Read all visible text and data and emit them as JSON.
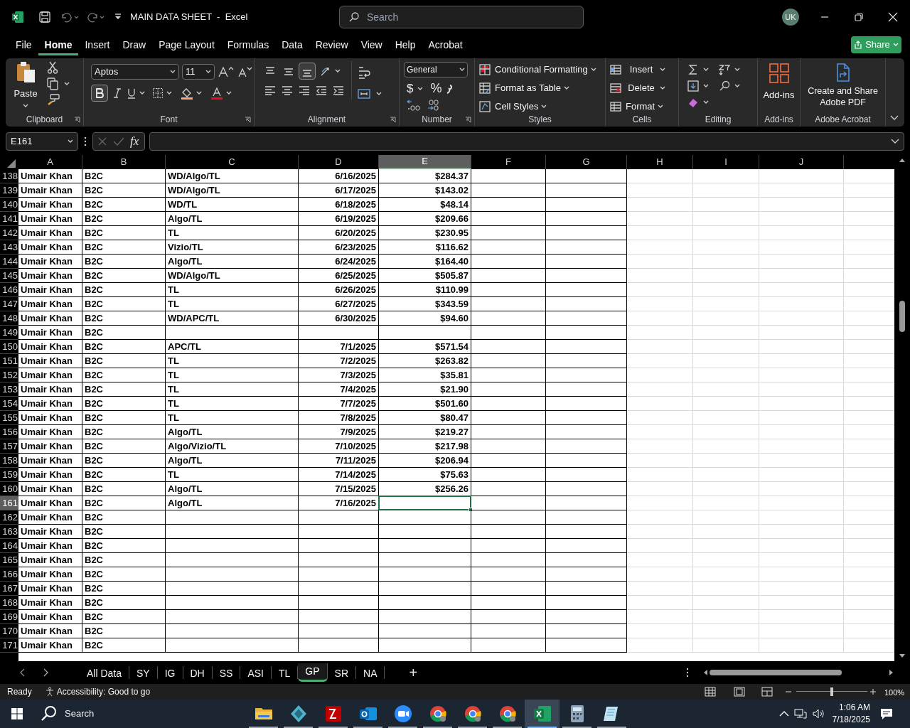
{
  "title_bar": {
    "title": "MAIN DATA SHEET  -  Excel",
    "search_placeholder": "Search",
    "avatar": "UK"
  },
  "menu_tabs": [
    {
      "label": "File",
      "selected": false
    },
    {
      "label": "Home",
      "selected": true
    },
    {
      "label": "Insert",
      "selected": false
    },
    {
      "label": "Draw",
      "selected": false
    },
    {
      "label": "Page Layout",
      "selected": false
    },
    {
      "label": "Formulas",
      "selected": false
    },
    {
      "label": "Data",
      "selected": false
    },
    {
      "label": "Review",
      "selected": false
    },
    {
      "label": "View",
      "selected": false
    },
    {
      "label": "Help",
      "selected": false
    },
    {
      "label": "Acrobat",
      "selected": false
    }
  ],
  "share_button": "Share",
  "ribbon": {
    "clipboard": {
      "label": "Clipboard",
      "paste": "Paste"
    },
    "font": {
      "label": "Font",
      "font_name": "Aptos",
      "font_size": "11",
      "bold_on": true
    },
    "alignment": {
      "label": "Alignment",
      "bottom_align_on": true
    },
    "number": {
      "label": "Number",
      "format": "General",
      "currency_symbol": "$",
      "percent_symbol": "%"
    },
    "styles": {
      "label": "Styles",
      "items": [
        "Conditional Formatting",
        "Format as Table",
        "Cell Styles"
      ]
    },
    "cells": {
      "label": "Cells",
      "items": [
        "Insert",
        "Delete",
        "Format"
      ]
    },
    "editing": {
      "label": "Editing"
    },
    "add_ins": {
      "label": "Add-ins",
      "button": "Add-ins"
    },
    "acrobat": {
      "label": "Adobe Acrobat",
      "button": "Create and Share Adobe PDF"
    }
  },
  "formula_bar": {
    "name_box": "E161",
    "fx": "fx"
  },
  "columns": [
    {
      "label": "A",
      "selected": false
    },
    {
      "label": "B",
      "selected": false
    },
    {
      "label": "C",
      "selected": false
    },
    {
      "label": "D",
      "selected": false
    },
    {
      "label": "E",
      "selected": true
    },
    {
      "label": "F",
      "selected": false
    },
    {
      "label": "G",
      "selected": false
    },
    {
      "label": "H",
      "selected": false
    },
    {
      "label": "I",
      "selected": false
    },
    {
      "label": "J",
      "selected": false
    }
  ],
  "rows": [
    {
      "n": "138",
      "a": "Umair Khan",
      "b": "B2C",
      "c": "WD/Algo/TL",
      "d": "6/16/2025",
      "e": "$284.37",
      "selected": false
    },
    {
      "n": "139",
      "a": "Umair Khan",
      "b": "B2C",
      "c": "WD/Algo/TL",
      "d": "6/17/2025",
      "e": "$143.02",
      "selected": false
    },
    {
      "n": "140",
      "a": "Umair Khan",
      "b": "B2C",
      "c": "WD/TL",
      "d": "6/18/2025",
      "e": "$48.14",
      "selected": false
    },
    {
      "n": "141",
      "a": "Umair Khan",
      "b": "B2C",
      "c": "Algo/TL",
      "d": "6/19/2025",
      "e": "$209.66",
      "selected": false
    },
    {
      "n": "142",
      "a": "Umair Khan",
      "b": "B2C",
      "c": "TL",
      "d": "6/20/2025",
      "e": "$230.95",
      "selected": false
    },
    {
      "n": "143",
      "a": "Umair Khan",
      "b": "B2C",
      "c": "Vizio/TL",
      "d": "6/23/2025",
      "e": "$116.62",
      "selected": false
    },
    {
      "n": "144",
      "a": "Umair Khan",
      "b": "B2C",
      "c": "Algo/TL",
      "d": "6/24/2025",
      "e": "$164.40",
      "selected": false
    },
    {
      "n": "145",
      "a": "Umair Khan",
      "b": "B2C",
      "c": "WD/Algo/TL",
      "d": "6/25/2025",
      "e": "$505.87",
      "selected": false
    },
    {
      "n": "146",
      "a": "Umair Khan",
      "b": "B2C",
      "c": "TL",
      "d": "6/26/2025",
      "e": "$110.99",
      "selected": false
    },
    {
      "n": "147",
      "a": "Umair Khan",
      "b": "B2C",
      "c": "TL",
      "d": "6/27/2025",
      "e": "$343.59",
      "selected": false
    },
    {
      "n": "148",
      "a": "Umair Khan",
      "b": "B2C",
      "c": "WD/APC/TL",
      "d": "6/30/2025",
      "e": "$94.60",
      "selected": false
    },
    {
      "n": "149",
      "a": "Umair Khan",
      "b": "B2C",
      "selected": false
    },
    {
      "n": "150",
      "a": "Umair Khan",
      "b": "B2C",
      "c": "APC/TL",
      "d": "7/1/2025",
      "e": "$571.54",
      "selected": false
    },
    {
      "n": "151",
      "a": "Umair Khan",
      "b": "B2C",
      "c": "TL",
      "d": "7/2/2025",
      "e": "$263.82",
      "selected": false
    },
    {
      "n": "152",
      "a": "Umair Khan",
      "b": "B2C",
      "c": "TL",
      "d": "7/3/2025",
      "e": "$35.81",
      "selected": false
    },
    {
      "n": "153",
      "a": "Umair Khan",
      "b": "B2C",
      "c": "TL",
      "d": "7/4/2025",
      "e": "$21.90",
      "selected": false
    },
    {
      "n": "154",
      "a": "Umair Khan",
      "b": "B2C",
      "c": "TL",
      "d": "7/7/2025",
      "e": "$501.60",
      "selected": false
    },
    {
      "n": "155",
      "a": "Umair Khan",
      "b": "B2C",
      "c": "TL",
      "d": "7/8/2025",
      "e": "$80.47",
      "selected": false
    },
    {
      "n": "156",
      "a": "Umair Khan",
      "b": "B2C",
      "c": "Algo/TL",
      "d": "7/9/2025",
      "e": "$219.27",
      "selected": false
    },
    {
      "n": "157",
      "a": "Umair Khan",
      "b": "B2C",
      "c": "Algo/Vizio/TL",
      "d": "7/10/2025",
      "e": "$217.98",
      "selected": false
    },
    {
      "n": "158",
      "a": "Umair Khan",
      "b": "B2C",
      "c": "Algo/TL",
      "d": "7/11/2025",
      "e": "$206.94",
      "selected": false
    },
    {
      "n": "159",
      "a": "Umair Khan",
      "b": "B2C",
      "c": "TL",
      "d": "7/14/2025",
      "e": "$75.63",
      "selected": false
    },
    {
      "n": "160",
      "a": "Umair Khan",
      "b": "B2C",
      "c": "Algo/TL",
      "d": "7/15/2025",
      "e": "$256.26",
      "selected": false
    },
    {
      "n": "161",
      "a": "Umair Khan",
      "b": "B2C",
      "c": "Algo/TL",
      "d": "7/16/2025",
      "selected": true
    },
    {
      "n": "162",
      "a": "Umair Khan",
      "b": "B2C",
      "selected": false
    },
    {
      "n": "163",
      "a": "Umair Khan",
      "b": "B2C",
      "selected": false
    },
    {
      "n": "164",
      "a": "Umair Khan",
      "b": "B2C",
      "selected": false
    },
    {
      "n": "165",
      "a": "Umair Khan",
      "b": "B2C",
      "selected": false
    },
    {
      "n": "166",
      "a": "Umair Khan",
      "b": "B2C",
      "selected": false
    },
    {
      "n": "167",
      "a": "Umair Khan",
      "b": "B2C",
      "selected": false
    },
    {
      "n": "168",
      "a": "Umair Khan",
      "b": "B2C",
      "selected": false
    },
    {
      "n": "169",
      "a": "Umair Khan",
      "b": "B2C",
      "selected": false
    },
    {
      "n": "170",
      "a": "Umair Khan",
      "b": "B2C",
      "selected": false
    },
    {
      "n": "171",
      "a": "Umair Khan",
      "b": "B2C",
      "selected": false
    }
  ],
  "sheet_tabs": [
    {
      "label": "All Data",
      "selected": false
    },
    {
      "label": "SY",
      "selected": false
    },
    {
      "label": "IG",
      "selected": false
    },
    {
      "label": "DH",
      "selected": false
    },
    {
      "label": "SS",
      "selected": false
    },
    {
      "label": "ASI",
      "selected": false
    },
    {
      "label": "TL",
      "selected": false
    },
    {
      "label": "GP",
      "selected": true
    },
    {
      "label": "SR",
      "selected": false
    },
    {
      "label": "NA",
      "selected": false
    }
  ],
  "new_sheet": "+",
  "status_bar": {
    "status": "Ready",
    "accessibility": "Accessibility: Good to go",
    "zoom": "100%",
    "zoom_level": {
      "level": 0.5
    }
  },
  "taskbar": {
    "search": "Search",
    "time": "1:06 AM",
    "date": "7/18/2025",
    "apps": [
      {
        "kind": "folder",
        "running": true,
        "selected": false
      },
      {
        "kind": "diamond",
        "running": true,
        "selected": false
      },
      {
        "kind": "ftp",
        "running": true,
        "selected": false
      },
      {
        "kind": "mail",
        "running": true,
        "selected": false
      },
      {
        "kind": "video",
        "running": true,
        "selected": false
      },
      {
        "kind": "browser",
        "running": true,
        "selected": false
      },
      {
        "kind": "browser",
        "running": true,
        "selected": false
      },
      {
        "kind": "browser",
        "running": true,
        "selected": false
      },
      {
        "kind": "sheet",
        "running": true,
        "selected": true
      },
      {
        "kind": "calculator",
        "running": true,
        "selected": false
      },
      {
        "kind": "notes",
        "running": true,
        "selected": false
      }
    ]
  }
}
